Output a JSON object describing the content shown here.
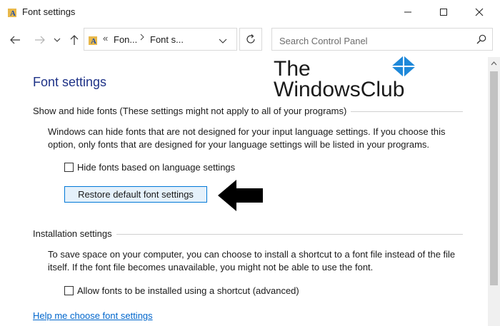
{
  "window": {
    "title": "Font settings"
  },
  "navigation": {
    "breadcrumbs": [
      "Fon...",
      "Font s..."
    ],
    "breadcrumb_overflow": "«",
    "search_placeholder": "Search Control Panel"
  },
  "watermark": {
    "line1": "The",
    "line2": "WindowsClub"
  },
  "main": {
    "page_title": "Font settings",
    "show_hide": {
      "title": "Show and hide fonts (These settings might not apply to all of your programs)",
      "description": "Windows can hide fonts that are not designed for your input language settings. If you choose this option, only fonts that are designed for your language settings will be listed in your programs.",
      "checkbox_label": "Hide fonts based on language settings",
      "checkbox_checked": false,
      "restore_button": "Restore default font settings"
    },
    "installation": {
      "title": "Installation settings",
      "description": "To save space on your computer, you can choose to install a shortcut to a font file instead of the file itself. If the font file becomes unavailable, you might not be able to use the font.",
      "checkbox_label": "Allow fonts to be installed using a shortcut (advanced)",
      "checkbox_checked": false
    },
    "help_link": "Help me choose font settings"
  },
  "colors": {
    "accent": "#0078d7",
    "title_blue": "#1e3287",
    "link": "#0066cc"
  }
}
